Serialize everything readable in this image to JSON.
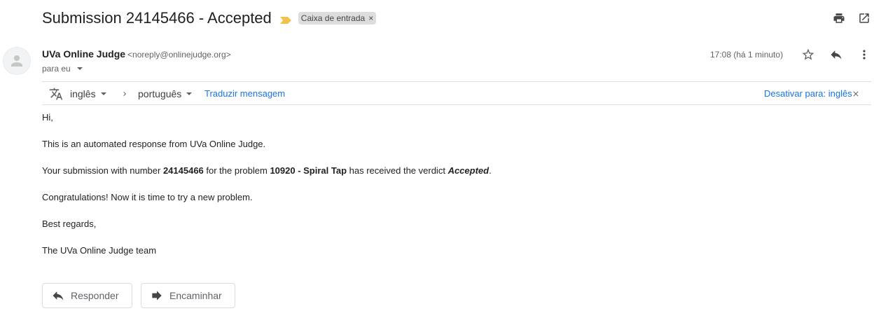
{
  "subject": {
    "title": "Submission 24145466 - Accepted",
    "label": "Caixa de entrada",
    "label_remove": "×"
  },
  "toolbar": {
    "print_icon": "printer-icon",
    "new_window_icon": "open-in-new-window-icon"
  },
  "sender": {
    "name": "UVa Online Judge",
    "email": "<noreply@onlinejudge.org>",
    "to": "para eu",
    "time": "17:08 (há 1 minuto)"
  },
  "translation": {
    "source_lang": "inglês",
    "target_lang": "português",
    "translate_link": "Traduzir mensagem",
    "disable_link": "Desativar para: inglês"
  },
  "message": {
    "greeting": "Hi,",
    "line1": "This is an automated response from UVa Online Judge.",
    "line2_pre": "Your submission with number ",
    "submission_number": "24145466",
    "line2_mid": " for the problem ",
    "problem": "10920 - Spiral Tap",
    "line2_mid2": " has received the verdict ",
    "verdict": "Accepted",
    "line2_end": ".",
    "line3": "Congratulations! Now it is time to try a new problem.",
    "closing": "Best regards,",
    "signature": "The UVa Online Judge team"
  },
  "actions": {
    "reply": "Responder",
    "forward": "Encaminhar"
  },
  "colors": {
    "link": "#1a73e8",
    "importance_marker": "#f2c14e",
    "chip_bg": "#dddddd"
  }
}
